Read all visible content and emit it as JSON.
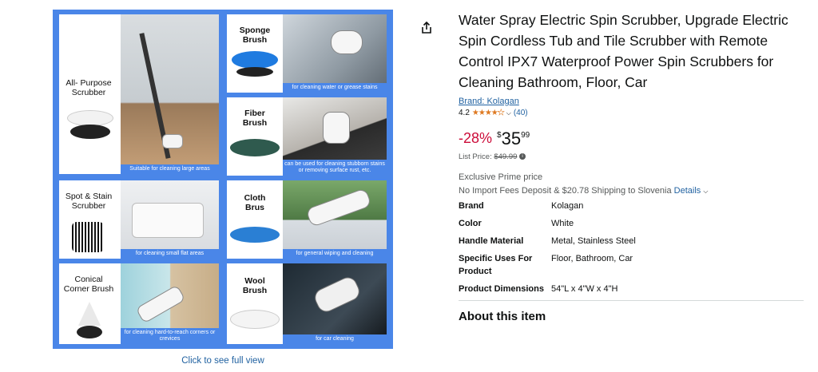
{
  "gallery": {
    "tiles": [
      {
        "label": "All- Purpose\nScrubber",
        "caption": "Suitable for cleaning large areas"
      },
      {
        "label": "Sponge\nBrush",
        "caption": "for cleaning water or grease stains"
      },
      {
        "label": "Fiber\nBrush",
        "caption": "can be used for cleaning stubborn stains or removing surface rust, etc."
      },
      {
        "label": "Spot & Stain\nScrubber",
        "caption": "for cleaning small flat areas"
      },
      {
        "label": "Cloth\nBrus",
        "caption": "for general wiping and cleaning"
      },
      {
        "label": "Conical\nCorner Brush",
        "caption": "for cleaning hard-to-reach corners or crevices"
      },
      {
        "label": "Wool\nBrush",
        "caption": "for car cleaning"
      }
    ],
    "see_full": "Click to see full view"
  },
  "product": {
    "title": "Water Spray Electric Spin Scrubber, Upgrade Electric Spin Cordless Tub and Tile Scrubber with Remote Control IPX7 Waterproof Power Spin Scrubbers for Cleaning Bathroom, Floor, Car",
    "brand_link": "Brand: Kolagan",
    "rating": "4.2",
    "rating_value": 4.2,
    "review_count": "(40)",
    "discount": "-28%",
    "currency": "$",
    "price_whole": "35",
    "price_fraction": "99",
    "list_price_label": "List Price:",
    "list_price": "$49.99",
    "prime_note": "Exclusive Prime price",
    "shipping": "No Import Fees Deposit & $20.78 Shipping to Slovenia",
    "details_link": "Details",
    "specs": [
      {
        "key": "Brand",
        "value": "Kolagan"
      },
      {
        "key": "Color",
        "value": "White"
      },
      {
        "key": "Handle Material",
        "value": "Metal, Stainless Steel"
      },
      {
        "key": "Specific Uses For Product",
        "value": "Floor, Bathroom, Car"
      },
      {
        "key": "Product Dimensions",
        "value": "54\"L x 4\"W x 4\"H"
      }
    ],
    "about_heading": "About this item"
  },
  "colors": {
    "link": "#2162a1",
    "deal": "#cc0c39",
    "star": "#de7921",
    "panel": "#4a86e8"
  }
}
